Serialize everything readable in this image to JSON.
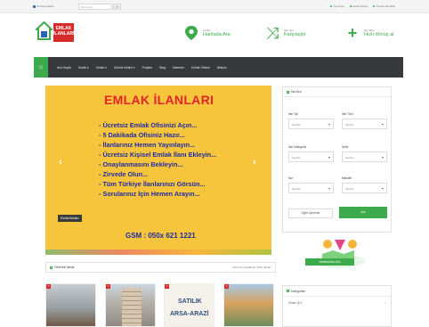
{
  "topbar": {
    "language": "Dil Seçenekleri",
    "search_placeholder": "Site İçi Ara",
    "links": [
      "Üye Girişi",
      "Hesap Oluştur",
      "Ücretsiz İlan Ekle"
    ]
  },
  "brand": {
    "line1": "EMLAK",
    "line2": "İLANLARI"
  },
  "header": {
    "map": {
      "label": "Harita",
      "value": "Haritada Ara"
    },
    "compare": {
      "label": "İlan Seç",
      "value": "Karşılaştır"
    },
    "add": {
      "label": "İlan Ekle",
      "value": "Hızlı dönüş al"
    }
  },
  "nav": {
    "items": [
      "Ana Sayfa",
      "Satılık ▾",
      "Kiralık ▾",
      "Günlük Kiralık ▾",
      "Projeler",
      "Blog",
      "Haberler",
      "Emlak Ofisleri",
      "İletişim"
    ]
  },
  "slider": {
    "title": "EMLAK İLANLARI",
    "lines": [
      "- Ücretsiz Emlak Ofisinizi Açın...",
      "- 5 Dakikada Ofisiniz Hazır...",
      "- İlanlarınız Hemen Yayınlayın...",
      "- Ücretsiz Kişisel Emlak İlanı Ekleyin...",
      "- Onaylanmasını Bekleyin...",
      "- Zirvede Olun...",
      "- Tüm Türkiye İlanlarınızı Görsün...",
      "- Sorularınız İçin Hemen Arayın..."
    ],
    "phone": "GSM : 050x 621 1221",
    "badge": "Emlak İlanları"
  },
  "search_panel": {
    "title": "İlan Ara",
    "fields": [
      {
        "label": "İlan Tipi",
        "value": "Seçiniz"
      },
      {
        "label": "İlan Türü",
        "value": "Seçiniz"
      },
      {
        "label": "İlan Kategorisi",
        "value": "Seçiniz"
      },
      {
        "label": "Şehir",
        "value": "Seçiniz"
      },
      {
        "label": "İlçe",
        "value": "Seçiniz"
      },
      {
        "label": "Mahalle",
        "value": "Seçiniz"
      }
    ],
    "detail_button": "Diğer Ayrıntılar",
    "search_button": "Ara"
  },
  "map_promo": {
    "button": "Haritada İlan Ara"
  },
  "listing": {
    "title": "Vitrindeki İlanlar",
    "right": "Sizin İçin Seçtiğimiz Vitrin İlanları",
    "thumbnails": [
      {
        "text1": "",
        "text2": ""
      },
      {
        "text1": "",
        "text2": ""
      },
      {
        "text1": "SATILIK",
        "text2": "ARSA-ARAZİ"
      },
      {
        "text1": "",
        "text2": ""
      }
    ]
  },
  "categories": {
    "title": "Kategoriler",
    "first": "Kiralık (67)"
  },
  "colors": {
    "accent": "#3daa4c",
    "nav_bg": "#37393d",
    "brand_red": "#d72b2b",
    "slider_bg": "#f6c53b"
  }
}
